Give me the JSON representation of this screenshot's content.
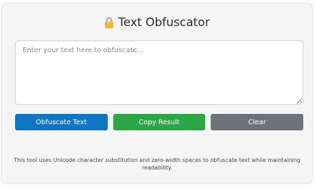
{
  "header": {
    "icon": "lock-icon",
    "title": "Text Obfuscator"
  },
  "input": {
    "placeholder": "Enter your text here to obfuscate...",
    "value": ""
  },
  "buttons": {
    "obfuscate_label": "Obfuscate Text",
    "copy_label": "Copy Result",
    "clear_label": "Clear"
  },
  "footer": {
    "note": "This tool uses Unicode character substitution and zero-width spaces to obfuscate text while maintaining readability."
  },
  "colors": {
    "obfuscate": "#0f76c4",
    "copy": "#2aa845",
    "clear": "#6c737b",
    "lock": "#f2b631"
  }
}
